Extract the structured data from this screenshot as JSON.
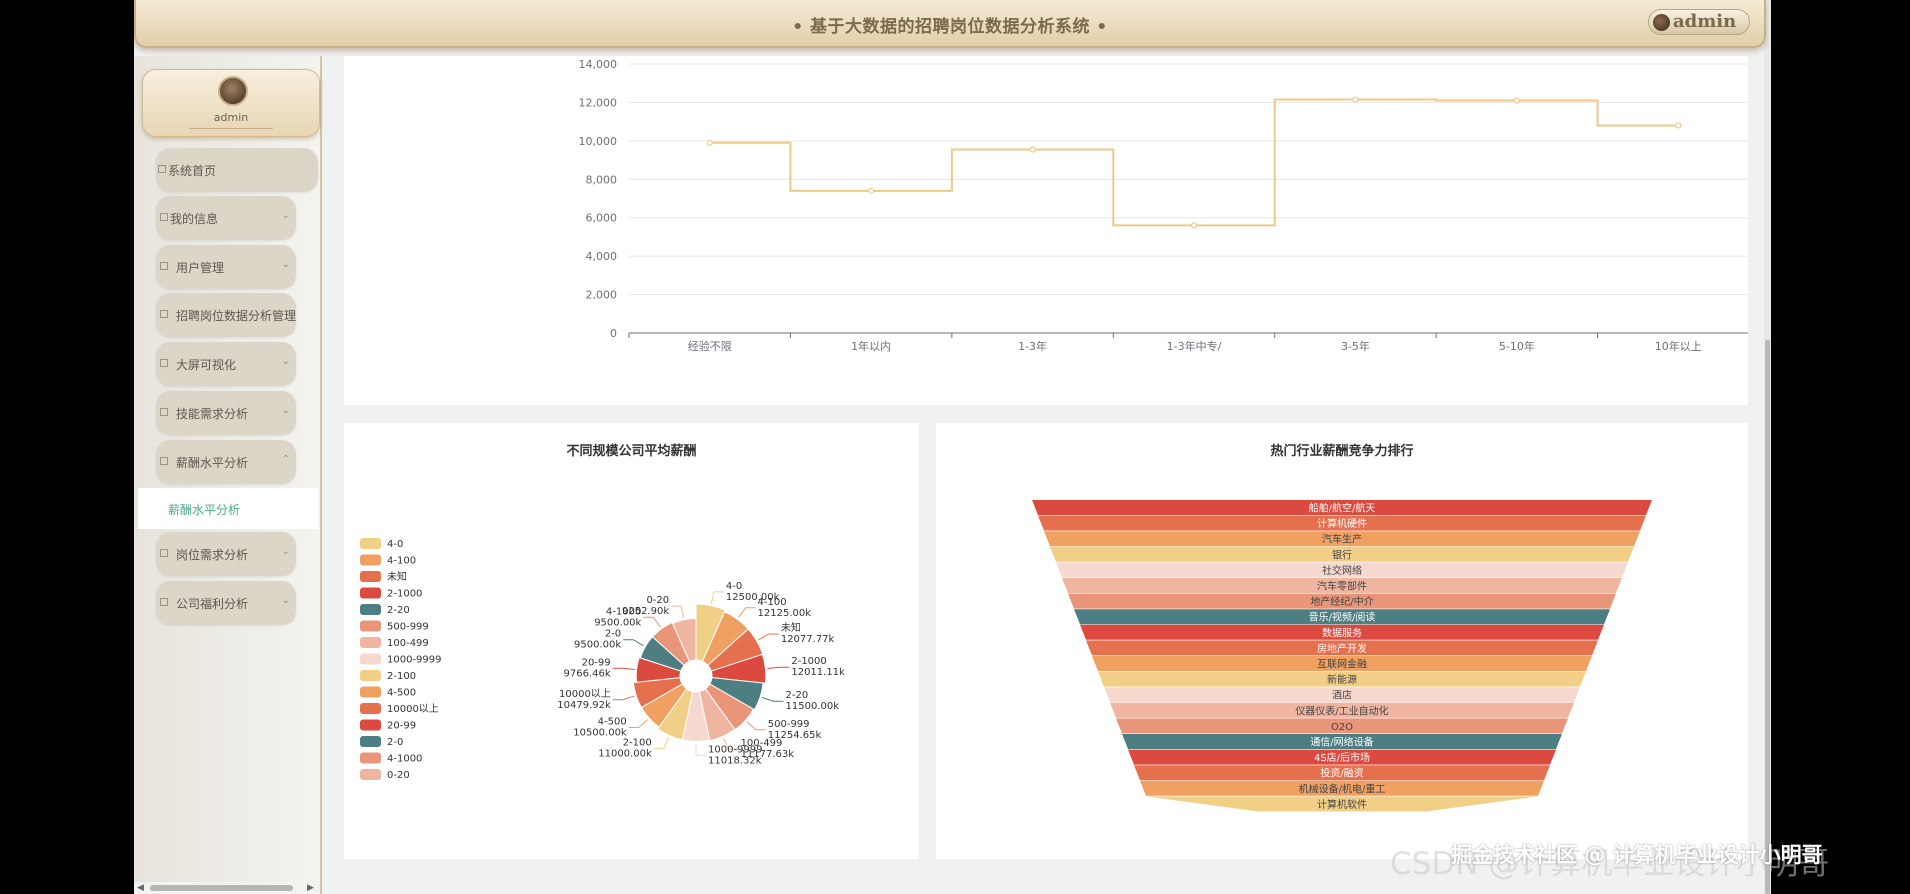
{
  "header": {
    "title": "• 基于大数据的招聘岗位数据分析系统 •",
    "user": "admin"
  },
  "sidebar": {
    "profile_name": "admin",
    "items": [
      {
        "label": "系统首页"
      },
      {
        "label": "我的信息"
      },
      {
        "label": "用户管理"
      },
      {
        "label": "招聘岗位数据分析管理"
      },
      {
        "label": "大屏可视化"
      },
      {
        "label": "技能需求分析"
      },
      {
        "label": "薪酬水平分析"
      },
      {
        "label": "岗位需求分析"
      },
      {
        "label": "公司福利分析"
      }
    ],
    "active_sub": "薪酬水平分析"
  },
  "watermark": {
    "small": "掘金技术社区 @ 计算机毕业设计小明哥",
    "big": "CSDN @计算机毕业设计小明哥"
  },
  "chart_data": [
    {
      "type": "line",
      "step": true,
      "categories": [
        "经验不限",
        "1年以内",
        "1-3年",
        "1-3年中专/",
        "3-5年",
        "5-10年",
        "10年以上"
      ],
      "values": [
        9900,
        7400,
        9550,
        5600,
        12150,
        12100,
        10800
      ],
      "ylim": [
        0,
        14000
      ],
      "yticks": [
        "0",
        "2,000",
        "4,000",
        "6,000",
        "8,000",
        "10,000",
        "12,000",
        "14,000"
      ],
      "color": "#f0c987",
      "grid": true
    },
    {
      "type": "pie",
      "rose": true,
      "title": "不同规模公司平均薪酬",
      "legend_placement": "left",
      "slices": [
        {
          "name": "4-0",
          "value": 12500.0,
          "label": "12500.00k",
          "color": "#f2cf86"
        },
        {
          "name": "4-100",
          "value": 12125.0,
          "label": "12125.00k",
          "color": "#f0a061"
        },
        {
          "name": "未知",
          "value": 12077.77,
          "label": "12077.77k",
          "color": "#e5704e"
        },
        {
          "name": "2-1000",
          "value": 12011.11,
          "label": "12011.11k",
          "color": "#dc4a3f"
        },
        {
          "name": "2-20",
          "value": 11500.0,
          "label": "11500.00k",
          "color": "#4d7e82"
        },
        {
          "name": "500-999",
          "value": 11254.65,
          "label": "11254.65k",
          "color": "#e9957a"
        },
        {
          "name": "100-499",
          "value": 11177.63,
          "label": "11177.63k",
          "color": "#f0b5a0"
        },
        {
          "name": "1000-9999",
          "value": 11018.32,
          "label": "11018.32k",
          "color": "#f6d8cf"
        },
        {
          "name": "2-100",
          "value": 11000.0,
          "label": "11000.00k",
          "color": "#f2cf86"
        },
        {
          "name": "4-500",
          "value": 10500.0,
          "label": "10500.00k",
          "color": "#f0a061"
        },
        {
          "name": "10000以上",
          "value": 10479.92,
          "label": "10479.92k",
          "color": "#e5704e"
        },
        {
          "name": "20-99",
          "value": 9766.46,
          "label": "9766.46k",
          "color": "#dc4a3f"
        },
        {
          "name": "2-0",
          "value": 9500.0,
          "label": "9500.00k",
          "color": "#4d7e82"
        },
        {
          "name": "4-1000",
          "value": 9500.0,
          "label": "9500.00k",
          "color": "#e9957a"
        },
        {
          "name": "0-20",
          "value": 9252.9,
          "label": "9252.90k",
          "color": "#f0b5a0"
        }
      ]
    },
    {
      "type": "funnel",
      "title": "热门行业薪酬竞争力排行",
      "items": [
        {
          "name": "船舶/航空/航天",
          "color": "#dc4a3f"
        },
        {
          "name": "计算机硬件",
          "color": "#e5704e"
        },
        {
          "name": "汽车生产",
          "color": "#f0a061"
        },
        {
          "name": "银行",
          "color": "#f2cf86"
        },
        {
          "name": "社交网络",
          "color": "#f6d8cf"
        },
        {
          "name": "汽车零部件",
          "color": "#f0b5a0"
        },
        {
          "name": "地产经纪/中介",
          "color": "#e9957a"
        },
        {
          "name": "音乐/视频/阅读",
          "color": "#4d7e82"
        },
        {
          "name": "数据服务",
          "color": "#dc4a3f"
        },
        {
          "name": "房地产开发",
          "color": "#e5704e"
        },
        {
          "name": "互联网金融",
          "color": "#f0a061"
        },
        {
          "name": "新能源",
          "color": "#f2cf86"
        },
        {
          "name": "酒店",
          "color": "#f6d8cf"
        },
        {
          "name": "仪器仪表/工业自动化",
          "color": "#f0b5a0"
        },
        {
          "name": "O2O",
          "color": "#e9957a"
        },
        {
          "name": "通信/网络设备",
          "color": "#4d7e82"
        },
        {
          "name": "4S店/后市场",
          "color": "#dc4a3f"
        },
        {
          "name": "投资/融资",
          "color": "#e5704e"
        },
        {
          "name": "机械设备/机电/重工",
          "color": "#f0a061"
        },
        {
          "name": "计算机软件",
          "color": "#f2cf86"
        }
      ]
    }
  ]
}
